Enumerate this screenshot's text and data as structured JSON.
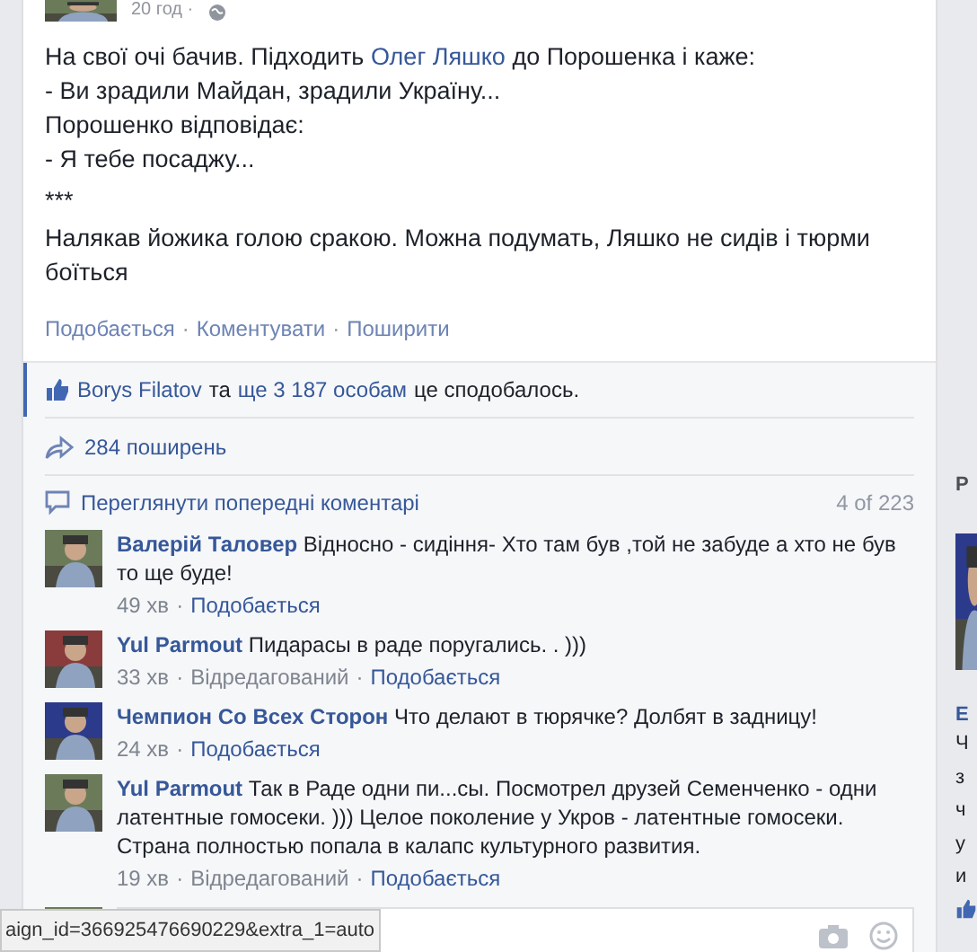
{
  "post": {
    "time": "20 год ·",
    "paragraphs": [
      {
        "before": "На свої очі бачив. Підходить ",
        "link": "Олег Ляшко",
        "after": " до Порошенка і каже:"
      },
      {
        "before": "- Ви зрадили Майдан, зрадили Україну..."
      },
      {
        "before": "Порошенко відповідає:"
      },
      {
        "before": "- Я тебе посаджу..."
      },
      {
        "before": "***"
      },
      {
        "before": "Налякав йожика голою сракою. Можна подумать, Ляшко не сидів і тюрми боїться"
      }
    ],
    "actions": [
      "Подобається",
      "Коментувати",
      "Поширити"
    ],
    "separator": "·"
  },
  "meta_separator": "·",
  "likes": {
    "name": "Borys Filatov",
    "joiner": "та",
    "others": "ще 3 187 особам",
    "tail": "це сподобалось."
  },
  "shares": "284 поширень",
  "comments_header": {
    "link": "Переглянути попередні коментарі",
    "count": "4 of 223"
  },
  "comments": [
    {
      "author": "Валерій Таловер",
      "text": "Відносно - сидіння- Хто там був ,той не забуде а хто не був то ще буде!",
      "time": "49 хв",
      "edited": false,
      "like": "Подобається"
    },
    {
      "author": "Yul Parmout",
      "text": "Пидарасы в раде поругались. . )))",
      "time": "33 хв",
      "edited": true,
      "edited_label": "Відредагований",
      "like": "Подобається"
    },
    {
      "author": "Чемпион Со Всех Сторон",
      "text": "Что делают в тюрячке? Долбят в задницу!",
      "time": "24 хв",
      "edited": false,
      "like": "Подобається"
    },
    {
      "author": "Yul Parmout",
      "text": "Так в Раде одни пи...сы. Посмотрел друзей Семенченко - одни латентные гомосеки. ))) Целое поколение у Укров - латентные гомосеки. Страна полностью попала в калапс культурного развития.",
      "time": "19 хв",
      "edited": true,
      "edited_label": "Відредагований",
      "like": "Подобається"
    }
  ],
  "sidebar": {
    "heading": "Р",
    "name": "E",
    "lines": [
      "Ч",
      "з",
      "ч",
      "у",
      "и"
    ]
  },
  "status_bar": "aign_id=366925476690229&extra_1=auto"
}
